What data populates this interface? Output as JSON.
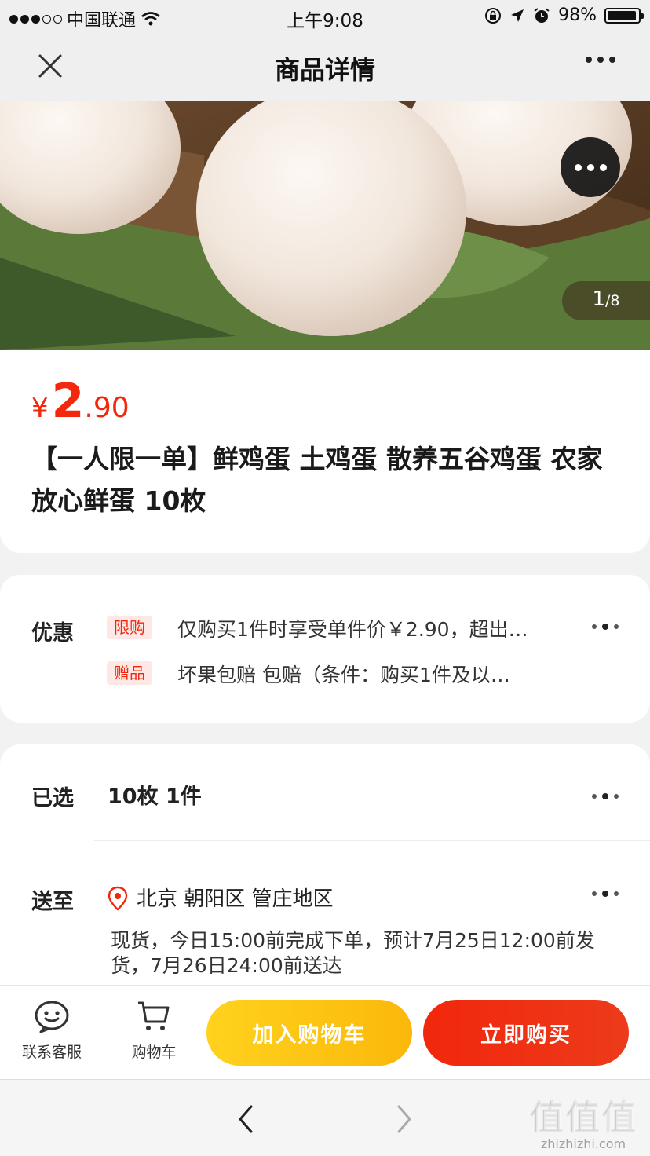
{
  "status_bar": {
    "carrier": "中国联通",
    "time": "上午9:08",
    "battery": "98%",
    "battery_level": 0.98,
    "signal_bars": 3
  },
  "nav": {
    "title": "商品详情",
    "close_icon": "close-icon",
    "more_icon": "more-icon"
  },
  "gallery": {
    "current": "1",
    "total": "/8",
    "more_icon": "more-icon"
  },
  "product": {
    "currency": "¥",
    "price_int": "2",
    "price_dec": ".90",
    "title": "【一人限一单】鲜鸡蛋 土鸡蛋 散养五谷鸡蛋 农家放心鲜蛋 10枚"
  },
  "promo": {
    "label": "优惠",
    "items": [
      {
        "tag": "限购",
        "text": "仅购买1件时享受单件价￥2.90，超出…"
      },
      {
        "tag": "赠品",
        "text": "坏果包赔 包赔（条件：购买1件及以…"
      }
    ]
  },
  "spec": {
    "selected_label": "已选",
    "selected_value": "10枚 1件",
    "ship_label": "送至",
    "address": "北京  朝阳区  管庄地区",
    "delivery": "现货，今日15:00前完成下单，预计7月25日12:00前发货，7月26日24:00前送达"
  },
  "actions": {
    "service_label": "联系客服",
    "cart_label": "购物车",
    "add_to_cart": "加入购物车",
    "buy_now": "立即购买"
  },
  "watermark": {
    "big": "值值值",
    "small": "zhizhizhi.com"
  },
  "colors": {
    "accent_red": "#f2270c",
    "accent_yellow": "#fbb80a"
  }
}
